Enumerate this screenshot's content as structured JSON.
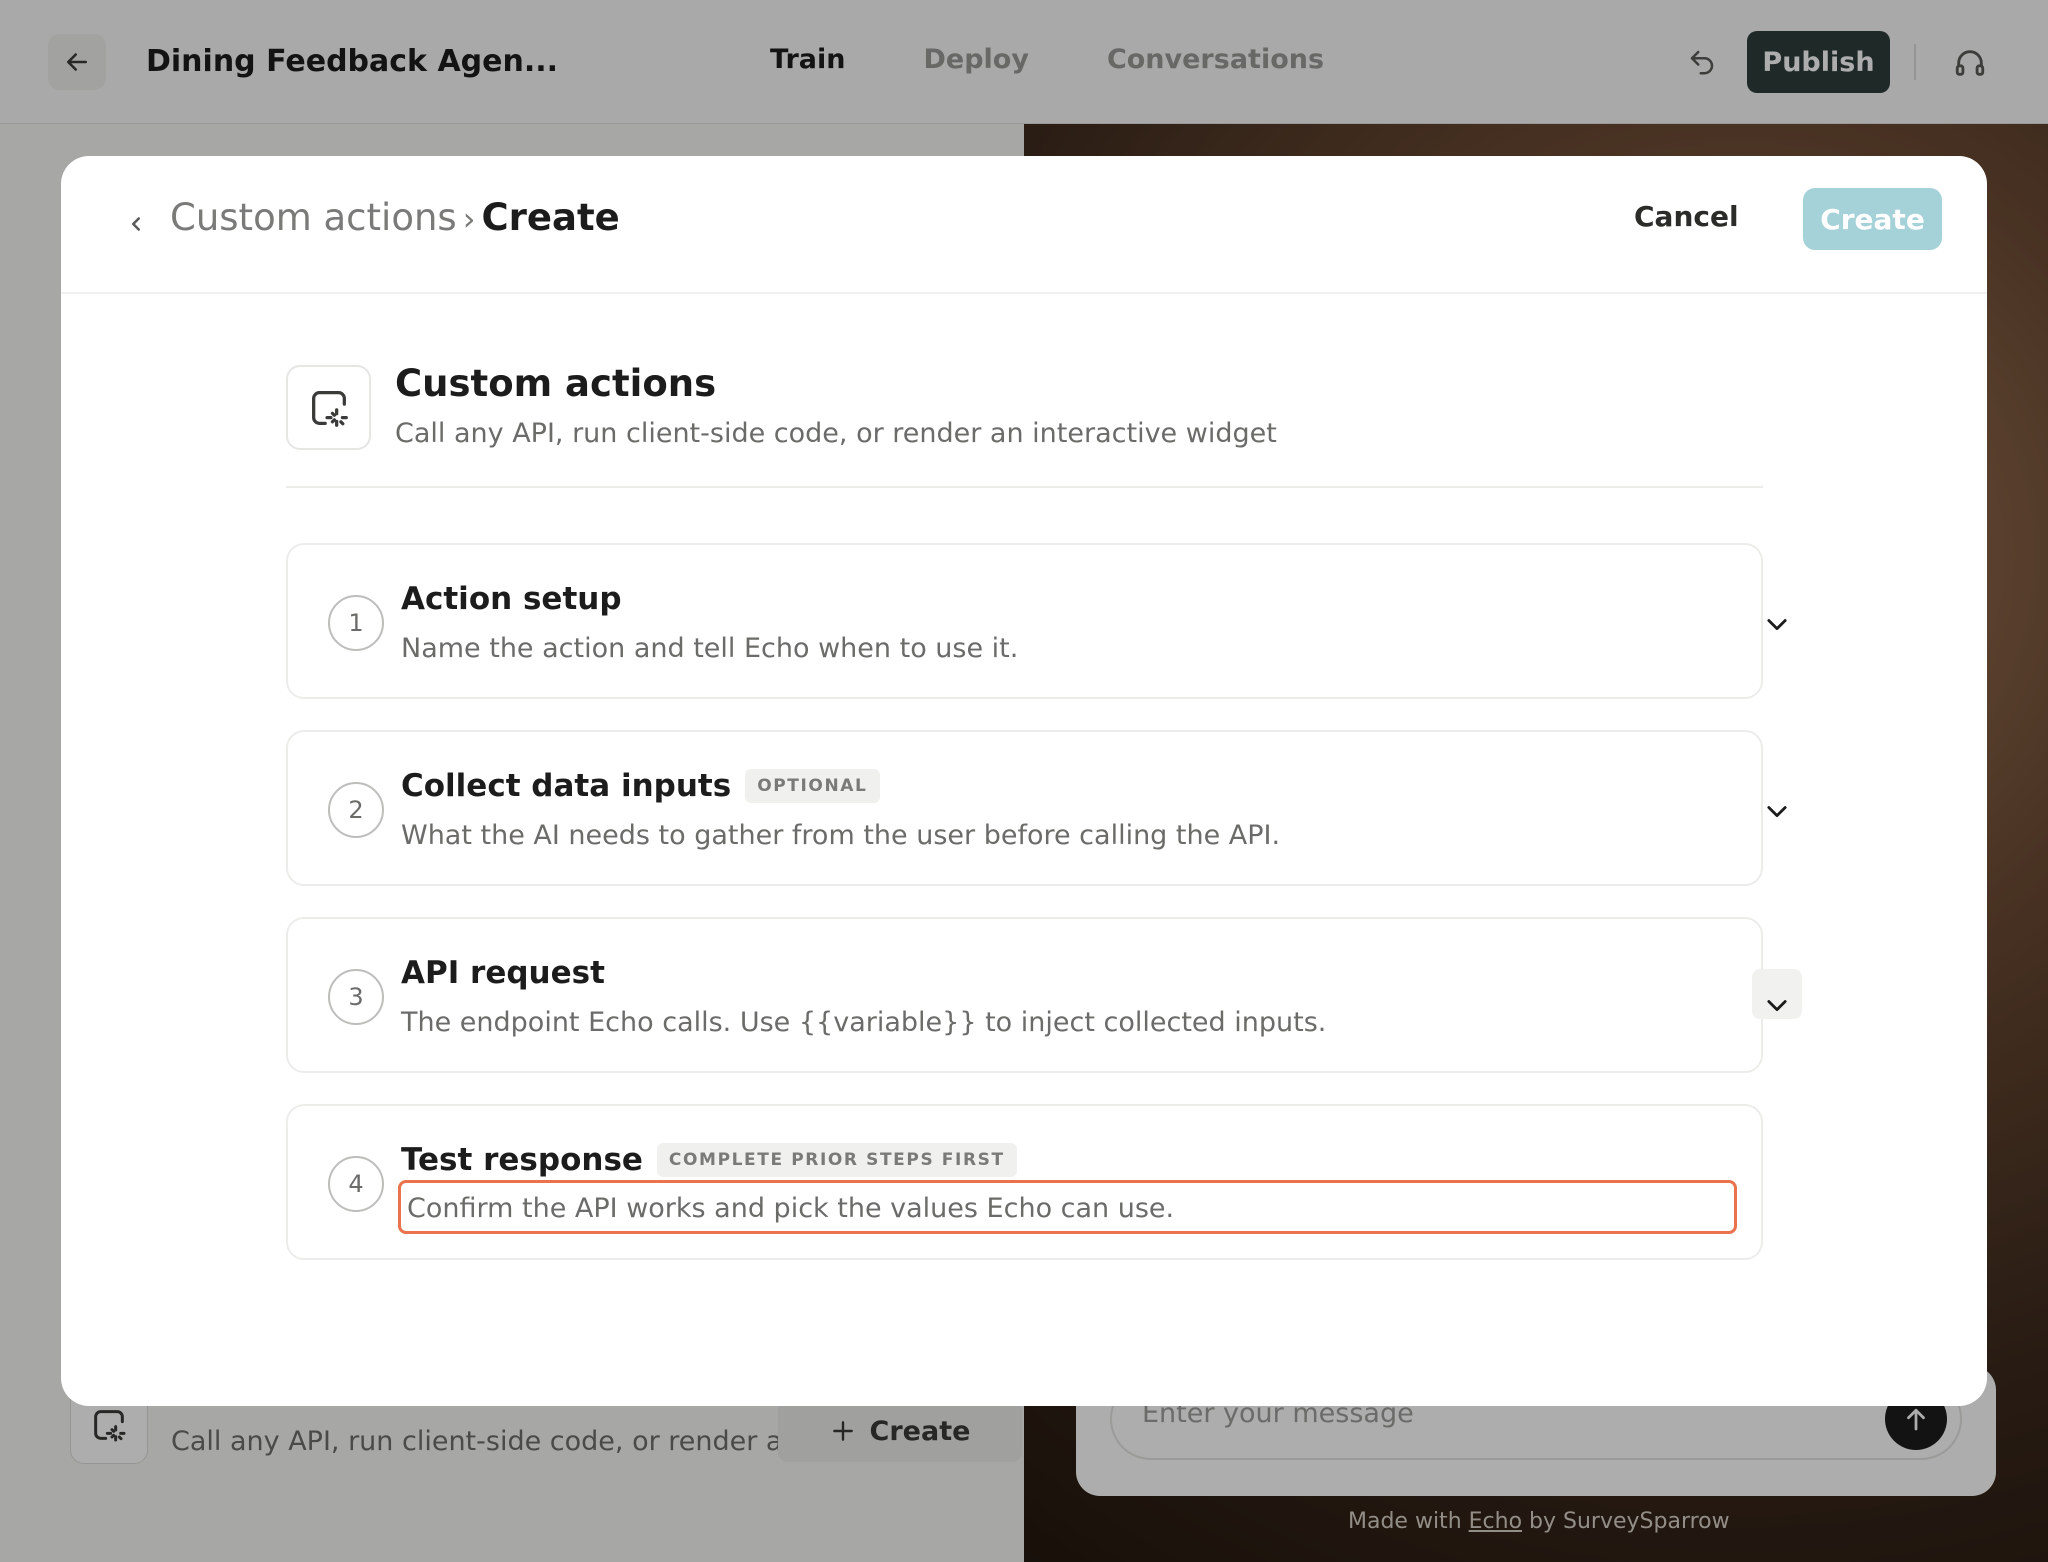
{
  "app": {
    "title": "Dining Feedback Agen...",
    "nav": [
      {
        "label": "Train",
        "active": true
      },
      {
        "label": "Deploy",
        "active": false
      },
      {
        "label": "Conversations",
        "active": false
      }
    ],
    "publish_label": "Publish",
    "back_icon": "arrow-left-icon",
    "undo_icon": "undo-icon",
    "support_icon": "headset-icon"
  },
  "background": {
    "card_description": "Call any API, run client-side code, or render a...",
    "create_label": "Create",
    "chat_placeholder": "Enter your message",
    "made_with_prefix": "Made with",
    "made_with_link": "Echo",
    "made_with_suffix": "by SurveySparrow"
  },
  "modal": {
    "breadcrumb": {
      "parent": "Custom actions",
      "separator": "›",
      "current": "Create"
    },
    "cancel_label": "Cancel",
    "create_label": "Create",
    "intro": {
      "title": "Custom actions",
      "description": "Call any API, run client-side code, or render an interactive widget"
    },
    "steps": [
      {
        "number": "1",
        "title": "Action setup",
        "badge": "",
        "description": "Name the action and tell Echo when to use it."
      },
      {
        "number": "2",
        "title": "Collect data inputs",
        "badge": "OPTIONAL",
        "description": "What the AI needs to gather from the user before calling the API."
      },
      {
        "number": "3",
        "title": "API request",
        "badge": "",
        "description": "The endpoint Echo calls. Use {{variable}} to inject collected inputs."
      },
      {
        "number": "4",
        "title": "Test response",
        "badge": "COMPLETE PRIOR STEPS FIRST",
        "description": "Confirm the API works and pick the values Echo can use."
      }
    ]
  },
  "colors": {
    "publish_bg": "#2e3f3c",
    "create_disabled_bg": "#a5d2d8",
    "focus_outline": "#e8734c"
  }
}
